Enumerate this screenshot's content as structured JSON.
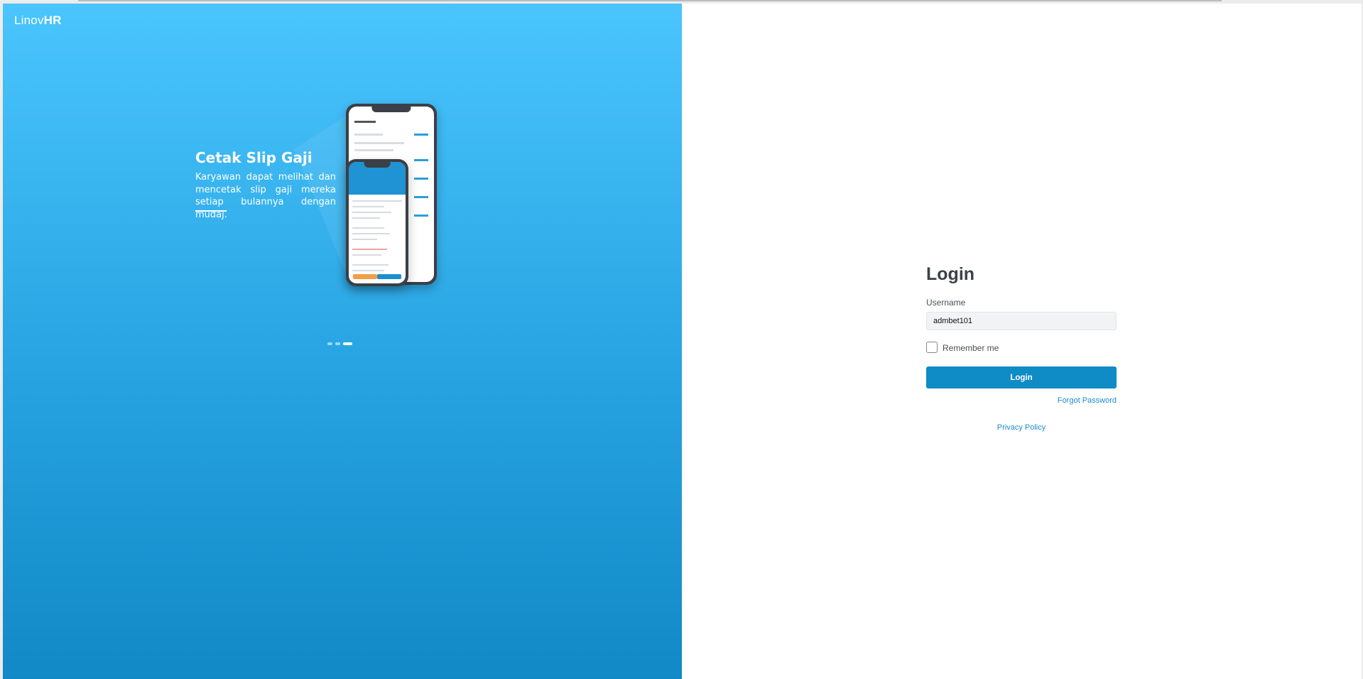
{
  "brand": {
    "name_light": "Linov",
    "name_bold": "HR"
  },
  "carousel": {
    "title": "Cetak Slip Gaji",
    "description": "Karyawan dapat melihat dan mencetak slip gaji mereka setiap bulannya dengan mudaj.",
    "slide_count": 3,
    "active_index": 2
  },
  "login": {
    "title": "Login",
    "username_label": "Username",
    "username_value": "admbet101",
    "remember_label": "Remember me",
    "remember_checked": false,
    "submit_label": "Login",
    "forgot_label": "Forgot Password",
    "privacy_label": "Privacy Policy"
  },
  "colors": {
    "panel_gradient_top": "#4ac5fd",
    "panel_gradient_bottom": "#1189c6",
    "primary_button": "#0f8bc6",
    "link": "#1a8ccc"
  }
}
